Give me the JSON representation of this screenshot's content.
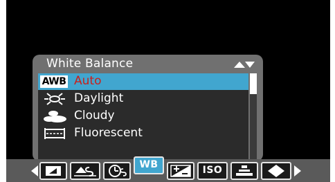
{
  "colors": {
    "screen_bg": "#000000",
    "panel_bg": "#707070",
    "list_bg": "#2b2b2b",
    "selection": "#41a6cf",
    "selected_text": "#c9201b",
    "toolbar_bg": "#5a5a5a"
  },
  "menu": {
    "title": "White Balance",
    "scroll_indicator_icon": "up-down-arrows-icon",
    "items": [
      {
        "icon": "awb-icon",
        "icon_text": "AWB",
        "label": "Auto",
        "selected": true
      },
      {
        "icon": "daylight-icon",
        "label": "Daylight",
        "selected": false
      },
      {
        "icon": "cloudy-icon",
        "label": "Cloudy",
        "selected": false
      },
      {
        "icon": "fluorescent-icon",
        "label": "Fluorescent",
        "selected": false
      }
    ]
  },
  "toolbar": {
    "buttons": [
      {
        "icon": "image-size-icon"
      },
      {
        "icon": "image-quality-icon"
      },
      {
        "icon": "self-timer-icon"
      },
      {
        "icon": "white-balance-icon",
        "text": "WB",
        "active": true
      },
      {
        "icon": "exposure-compensation-icon"
      },
      {
        "text": "ISO"
      },
      {
        "icon": "metering-icon"
      },
      {
        "icon": "flash-mode-icon"
      }
    ],
    "left_arrow_icon": "triangle-left-icon",
    "right_arrow_icon": "triangle-right-icon"
  }
}
